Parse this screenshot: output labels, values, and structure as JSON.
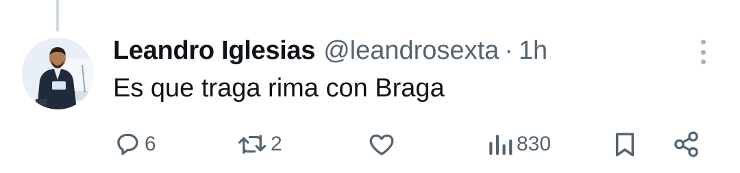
{
  "tweet": {
    "author_name": "Leandro Iglesias",
    "handle": "@leandrosexta",
    "separator": "·",
    "time": "1h",
    "text": "Es que traga rima con Braga"
  },
  "actions": {
    "reply_count": "6",
    "retweet_count": "2",
    "views_count": "830"
  },
  "icons": {
    "reply": "reply-bubble-icon",
    "retweet": "retweet-icon",
    "like": "heart-icon",
    "views": "views-chart-icon",
    "bookmark": "bookmark-icon",
    "share": "share-icon",
    "more": "more-dots-icon"
  },
  "colors": {
    "text_primary": "#0f1419",
    "text_secondary": "#536471",
    "thread_line": "#cfd9de"
  }
}
